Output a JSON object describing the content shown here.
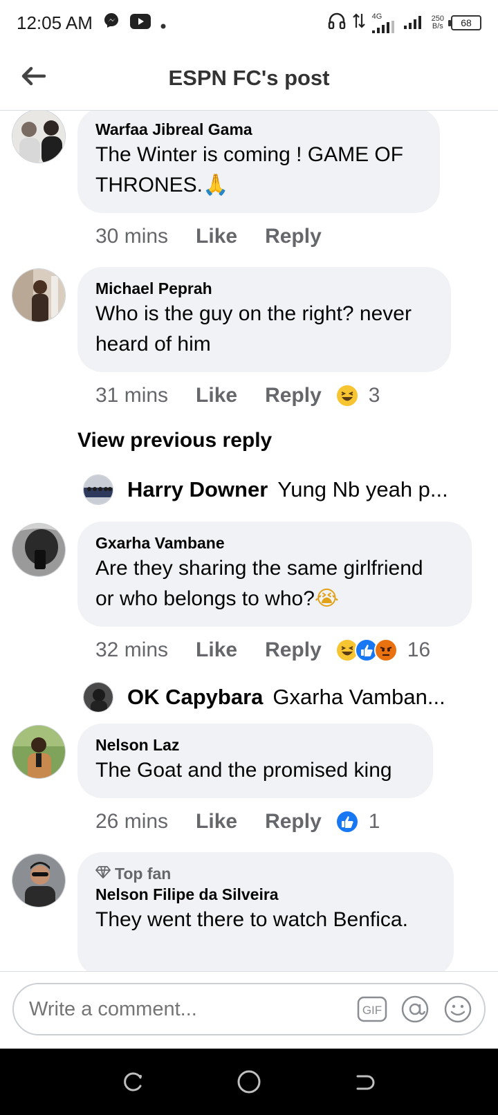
{
  "status_bar": {
    "time": "12:05 AM",
    "network": "4G",
    "speed_value": "250",
    "speed_unit": "B/s",
    "battery": "68"
  },
  "header": {
    "title": "ESPN FC's post"
  },
  "comments": [
    {
      "author": "Warfaa Jibreal Gama",
      "text_line1": "The Winter is coming ! GAME OF",
      "text_line2": "THRONES.",
      "text_emoji": "🙏",
      "time": "30 mins",
      "like_label": "Like",
      "reply_label": "Reply"
    },
    {
      "author": "Michael Peprah",
      "text_line1": "Who is the guy on the right? never",
      "text_line2": "heard of him",
      "time": "31 mins",
      "like_label": "Like",
      "reply_label": "Reply",
      "reaction_count": "3",
      "reactions": [
        "haha"
      ],
      "view_previous": "View previous reply",
      "reply_preview": {
        "name": "Harry Downer",
        "snippet": "Yung Nb yeah p..."
      }
    },
    {
      "author": "Gxarha Vambane",
      "text_line1": "Are they sharing the same girlfriend",
      "text_line2": "or who belongs to who?",
      "text_emoji": "😭",
      "time": "32 mins",
      "like_label": "Like",
      "reply_label": "Reply",
      "reaction_count": "16",
      "reactions": [
        "haha",
        "like",
        "angry"
      ],
      "reply_preview": {
        "name": "OK Capybara",
        "snippet": "Gxarha Vamban..."
      }
    },
    {
      "author": "Nelson Laz",
      "text_line1": "The Goat and the promised king",
      "time": "26 mins",
      "like_label": "Like",
      "reply_label": "Reply",
      "reaction_count": "1",
      "reactions": [
        "like"
      ]
    },
    {
      "badge": "Top fan",
      "author": "Nelson Filipe da Silveira",
      "text_line1": "They went there to watch Benfica."
    }
  ],
  "composer": {
    "placeholder": "Write a comment...",
    "gif_label": "GIF"
  },
  "colors": {
    "bubble": "#f0f2f5",
    "secondary_text": "#65676b",
    "like_blue": "#1877f2",
    "haha_yellow": "#f7c531",
    "angry_orange": "#e9710f"
  }
}
